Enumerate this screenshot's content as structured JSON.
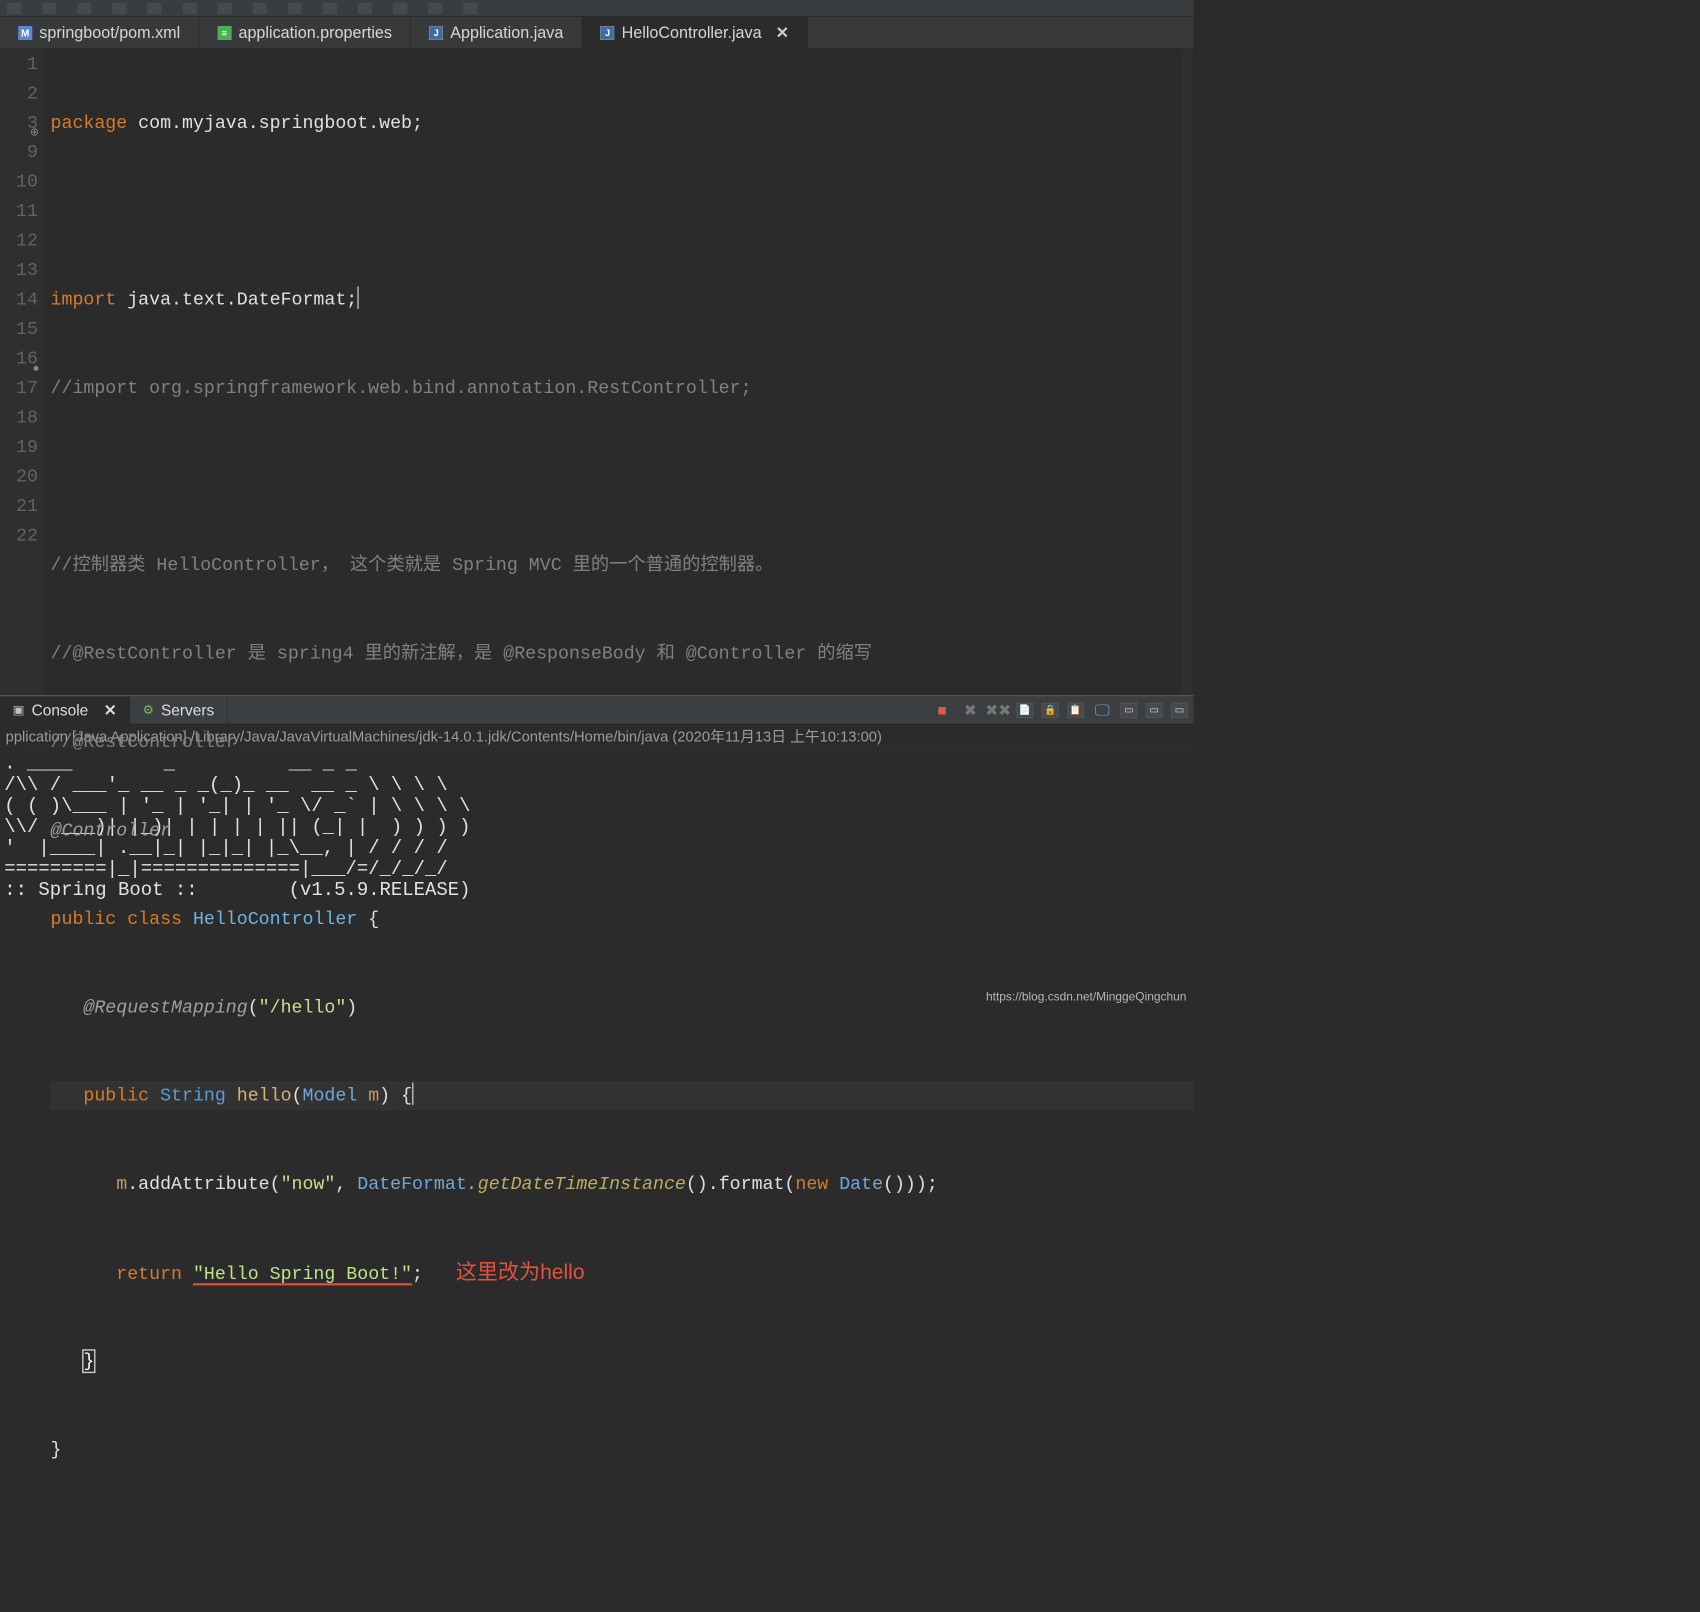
{
  "toolbar": {
    "icons": [
      "tri",
      "copy",
      "paste",
      "save",
      "undo",
      "redo",
      "run",
      "debug"
    ]
  },
  "tabs": [
    {
      "icon": "xml",
      "label": "springboot/pom.xml",
      "active": false,
      "closable": false
    },
    {
      "icon": "prop",
      "label": "application.properties",
      "active": false,
      "closable": false
    },
    {
      "icon": "java",
      "label": "Application.java",
      "active": false,
      "closable": false
    },
    {
      "icon": "java",
      "label": "HelloController.java",
      "active": true,
      "closable": true
    }
  ],
  "gutter_lines": [
    "1",
    "2",
    "3",
    "9",
    "10",
    "11",
    "12",
    "13",
    "14",
    "15",
    "16",
    "17",
    "18",
    "19",
    "20",
    "21",
    "22"
  ],
  "gutter_marks": {
    "3": "plus",
    "16": "dot"
  },
  "code": {
    "l1": {
      "kw": "package",
      "rest": " com.myjava.springboot.web;"
    },
    "l3": {
      "kw": "import",
      "rest": " java.text.DateFormat;"
    },
    "l9": "//import org.springframework.web.bind.annotation.RestController;",
    "l11": "//控制器类 HelloController， 这个类就是 Spring MVC 里的一个普通的控制器。",
    "l12": "//@RestController 是 spring4 里的新注解，是 @ResponseBody 和 @Controller 的缩写",
    "l13": "//@RestController",
    "l14": "@Controller",
    "l15": {
      "pub": "public",
      "cls": "class",
      "name": "HelloController",
      "brace": " {"
    },
    "l16": {
      "anno": "@RequestMapping",
      "arg": "\"/hello\""
    },
    "l17": {
      "pub": "public",
      "ret": "String",
      "name": "hello",
      "ptype": "Model",
      "pname": "m",
      "brace": " {"
    },
    "l18": {
      "m": "m",
      "add": ".addAttribute(",
      "arg1": "\"now\"",
      "df": "DateFormat",
      "inst": ".getDateTimeInstance",
      "fmt": "().format(",
      "nw": "new",
      "date": "Date",
      "tail": "()));"
    },
    "l19": {
      "ret": "return",
      "str": "\"Hello Spring Boot!\"",
      "semi": ";",
      "note": "这里改为hello"
    },
    "l20": "}",
    "l21": "}"
  },
  "panel_tabs": [
    {
      "label": "Console",
      "active": true,
      "closable": true
    },
    {
      "label": "Servers",
      "active": false,
      "closable": false
    }
  ],
  "panel_actions": [
    "stop",
    "remove",
    "remove-all",
    "doc1",
    "doc2",
    "doc3",
    "screen",
    "window",
    "ext"
  ],
  "console_meta": "pplication [Java Application] /Library/Java/JavaVirtualMachines/jdk-14.0.1.jdk/Contents/Home/bin/java  (2020年11月13日 上午10:13:00)",
  "console_banner": ". ____        _          __ _ _\n/\\\\ / ___'_ __ _ _(_)_ __  __ _ \\ \\ \\ \\\n( ( )\\___ | '_ | '_| | '_ \\/ _` | \\ \\ \\ \\\n\\\\/  ___)| |_)| | | | | || (_| |  ) ) ) )\n'  |____| .__|_| |_|_| |_\\__, | / / / /\n=========|_|==============|___/=/_/_/_/\n:: Spring Boot ::        (v1.5.9.RELEASE)",
  "watermark": "https://blog.csdn.net/MinggeQingchun"
}
